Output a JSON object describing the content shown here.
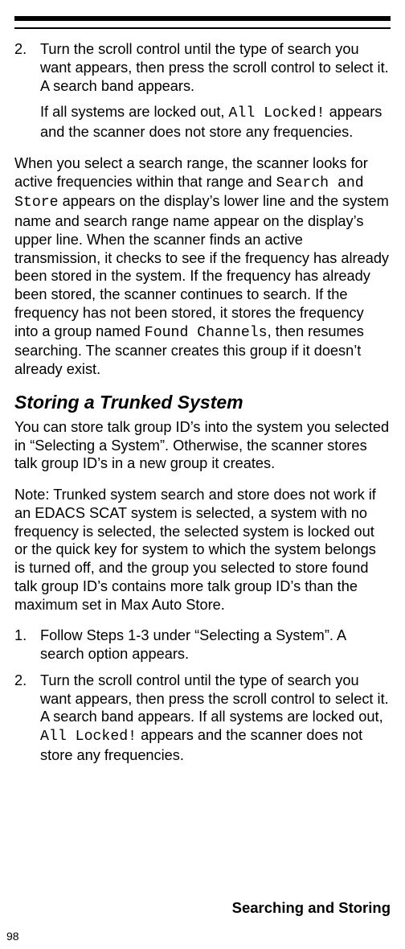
{
  "step2": {
    "num": "2.",
    "text_a": "Turn the scroll control until the type of search you want appears, then press the scroll control to select it. A search band appears.",
    "sub_a": "If all systems are locked out, ",
    "sub_code": "All Locked!",
    "sub_b": " appears and the scanner does not store any frequencies."
  },
  "para1": {
    "a": "When you select a search range, the scanner looks for active frequencies within that range and ",
    "code1": "Search and Store",
    "b": " appears on the display’s lower line and the system name and search range name appear on the display’s upper line. When the scanner finds an active transmission, it checks to see if the frequency has already been stored in the system. If the frequency has already been stored, the scanner continues to search. If the frequency has not been stored, it stores the frequency into a group named ",
    "code2": "Found Channels",
    "c": ", then resumes searching. The scanner creates this group if it doesn’t already exist."
  },
  "heading": "Storing a Trunked System",
  "para2": "You can store talk group ID’s into the system you selected in “Selecting a System”. Otherwise, the scanner stores talk group ID’s in a new group it creates.",
  "note": "Note: Trunked system search and store does not work if an EDACS SCAT system is selected, a system with no frequency is selected, the selected system is locked out or the quick key for system to which the system belongs is turned off, and the group you selected to store found talk group ID’s contains more talk group ID’s than the maximum set in Max Auto Store.",
  "step_b1": {
    "num": "1.",
    "text": "Follow Steps 1-3 under “Selecting a System”. A search option appears."
  },
  "step_b2": {
    "num": "2.",
    "a": "Turn the scroll control until the type of search you want appears, then press the scroll control to select it. A search band appears. If all systems are locked out, ",
    "code": "All Locked!",
    "b": " appears and the scanner does not store any frequencies."
  },
  "footer_section": "Searching and Storing",
  "page_number": "98"
}
